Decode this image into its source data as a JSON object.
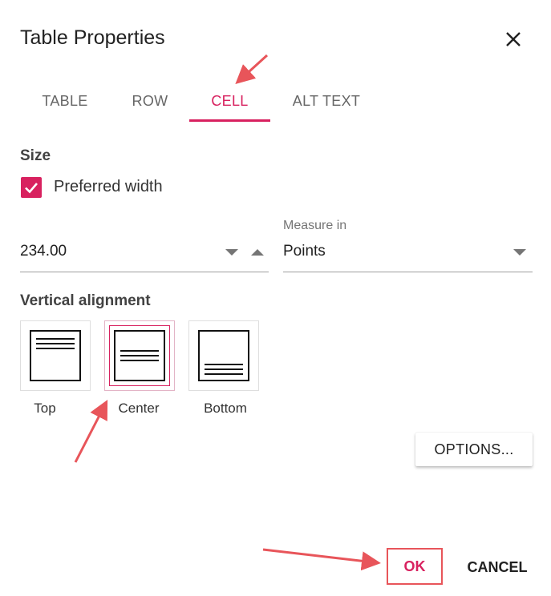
{
  "dialog": {
    "title": "Table Properties",
    "close_icon": "close-icon"
  },
  "tabs": [
    {
      "label": "TABLE",
      "active": false
    },
    {
      "label": "ROW",
      "active": false
    },
    {
      "label": "CELL",
      "active": true
    },
    {
      "label": "ALT TEXT",
      "active": false
    }
  ],
  "size": {
    "heading": "Size",
    "preferred_width_label": "Preferred width",
    "preferred_width_checked": true,
    "width_value": "234.00",
    "measure_label": "Measure in",
    "measure_value": "Points"
  },
  "vertical_alignment": {
    "heading": "Vertical alignment",
    "options": [
      {
        "label": "Top",
        "icon": "align-top-icon",
        "selected": false
      },
      {
        "label": "Center",
        "icon": "align-center-icon",
        "selected": true
      },
      {
        "label": "Bottom",
        "icon": "align-bottom-icon",
        "selected": false
      }
    ]
  },
  "buttons": {
    "options": "OPTIONS...",
    "ok": "OK",
    "cancel": "CANCEL"
  },
  "colors": {
    "accent": "#d8215f",
    "annotation": "#e8555a"
  }
}
